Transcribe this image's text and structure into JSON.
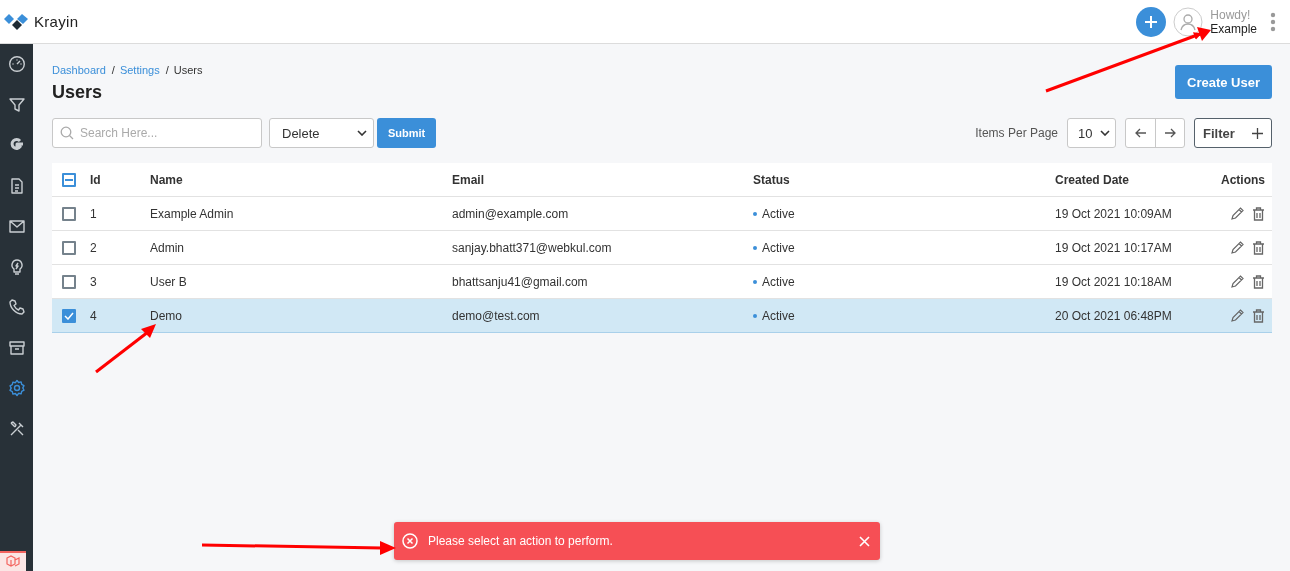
{
  "header": {
    "brand": "Krayin",
    "greeting": "Howdy!",
    "user_name": "Example"
  },
  "sidebar": {
    "items": [
      {
        "kind": "dashboard",
        "selected": false
      },
      {
        "kind": "leads",
        "selected": false
      },
      {
        "kind": "google",
        "selected": false
      },
      {
        "kind": "quotes",
        "selected": false
      },
      {
        "kind": "mail",
        "selected": false
      },
      {
        "kind": "activities",
        "selected": false
      },
      {
        "kind": "contacts",
        "selected": false
      },
      {
        "kind": "products",
        "selected": false
      },
      {
        "kind": "settings",
        "selected": true
      },
      {
        "kind": "configuration",
        "selected": false
      }
    ]
  },
  "breadcrumb_separator": "/",
  "breadcrumbs": [
    {
      "label": "Dashboard",
      "link": true
    },
    {
      "label": "Settings",
      "link": true
    },
    {
      "label": "Users",
      "link": false
    }
  ],
  "page_title": "Users",
  "create_button": "Create User",
  "toolbar": {
    "search_placeholder": "Search Here...",
    "mass_action": "Delete",
    "submit": "Submit",
    "per_page_label": "Items Per Page",
    "per_page": "10",
    "filter": "Filter"
  },
  "table": {
    "select_all": {
      "indeterminate": true
    },
    "columns": [
      "Id",
      "Name",
      "Email",
      "Status",
      "Created Date",
      "Actions"
    ],
    "rows": [
      {
        "selected": false,
        "id": "1",
        "name": "Example Admin",
        "email": "admin@example.com",
        "status": "Active",
        "created": "19 Oct 2021 10:09AM"
      },
      {
        "selected": false,
        "id": "2",
        "name": "Admin",
        "email": "sanjay.bhatt371@webkul.com",
        "status": "Active",
        "created": "19 Oct 2021 10:17AM"
      },
      {
        "selected": false,
        "id": "3",
        "name": "User B",
        "email": "bhattsanju41@gmail.com",
        "status": "Active",
        "created": "19 Oct 2021 10:18AM"
      },
      {
        "selected": true,
        "id": "4",
        "name": "Demo",
        "email": "demo@test.com",
        "status": "Active",
        "created": "20 Oct 2021 06:48PM"
      }
    ]
  },
  "toast": {
    "kind": "error",
    "message": "Please select an action to perform."
  }
}
